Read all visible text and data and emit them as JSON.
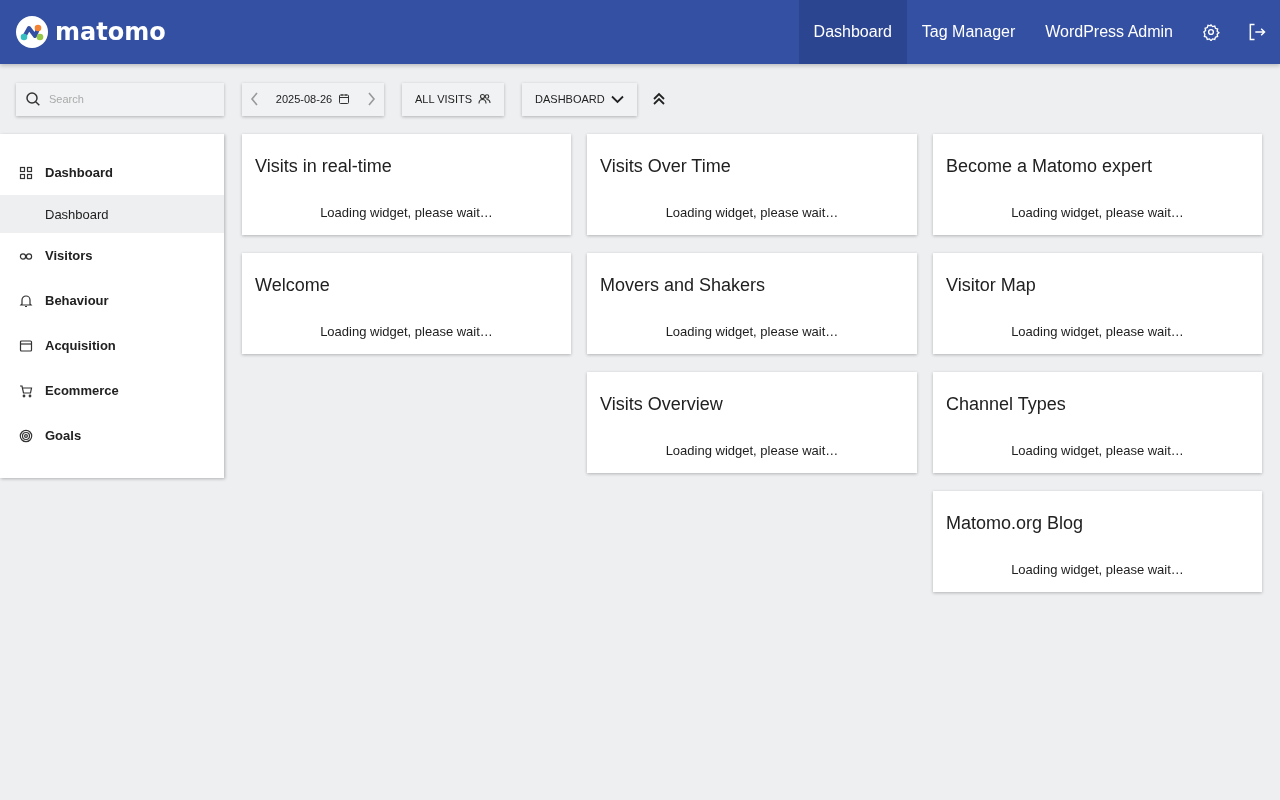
{
  "header": {
    "logo_text": "matomo",
    "nav": [
      {
        "label": "Dashboard",
        "selected": true
      },
      {
        "label": "Tag Manager",
        "selected": false
      },
      {
        "label": "WordPress Admin",
        "selected": false
      }
    ]
  },
  "toolbar": {
    "search": {
      "placeholder": "Search"
    },
    "date": "2025-08-26",
    "segment": "ALL VISITS",
    "dashboard": "DASHBOARD"
  },
  "sidebar": {
    "items": [
      {
        "label": "Dashboard",
        "children": [
          {
            "label": "Dashboard",
            "selected": true
          }
        ]
      },
      {
        "label": "Visitors"
      },
      {
        "label": "Behaviour"
      },
      {
        "label": "Acquisition"
      },
      {
        "label": "Ecommerce"
      },
      {
        "label": "Goals"
      }
    ]
  },
  "widget_columns": [
    [
      {
        "title": "Visits in real-time",
        "status": "Loading widget, please wait…"
      },
      {
        "title": "Welcome",
        "status": "Loading widget, please wait…"
      }
    ],
    [
      {
        "title": "Visits Over Time",
        "status": "Loading widget, please wait…"
      },
      {
        "title": "Movers and Shakers",
        "status": "Loading widget, please wait…"
      },
      {
        "title": "Visits Overview",
        "status": "Loading widget, please wait…"
      }
    ],
    [
      {
        "title": "Become a Matomo expert",
        "status": "Loading widget, please wait…"
      },
      {
        "title": "Visitor Map",
        "status": "Loading widget, please wait…"
      },
      {
        "title": "Channel Types",
        "status": "Loading widget, please wait…"
      },
      {
        "title": "Matomo.org Blog",
        "status": "Loading widget, please wait…"
      }
    ]
  ]
}
